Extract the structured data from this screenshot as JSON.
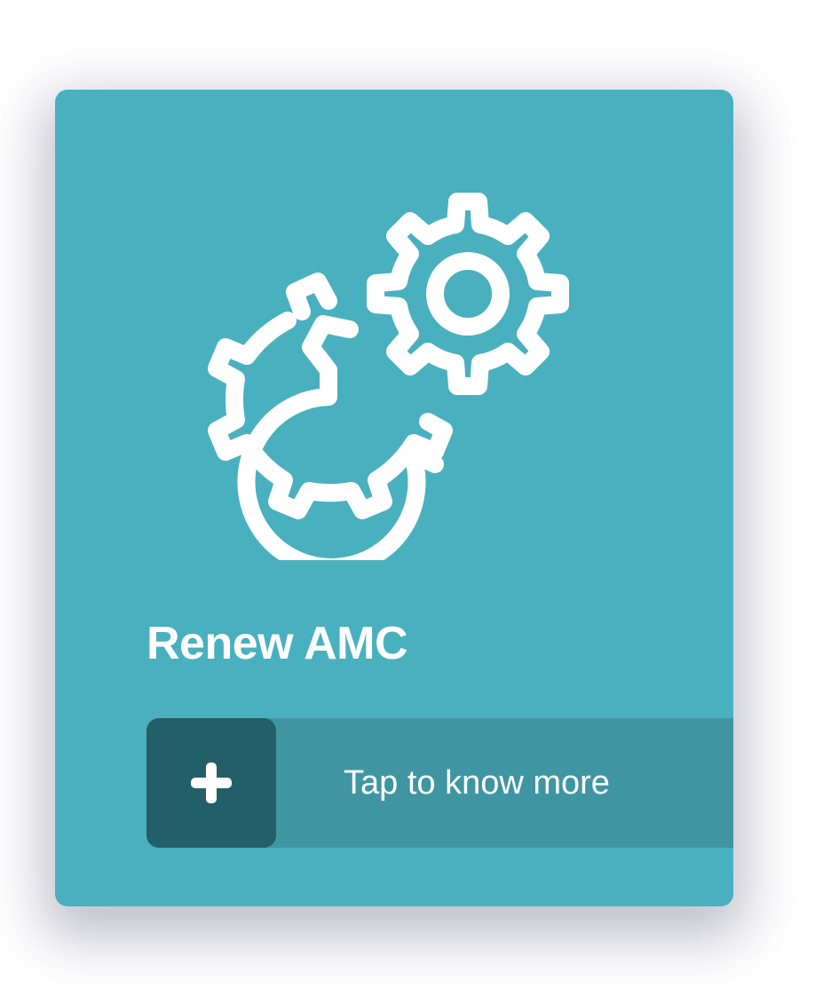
{
  "card": {
    "title": "Renew AMC",
    "icon": "gears-icon",
    "background_color": "#49b0bf",
    "cta": {
      "label": "Tap to know more",
      "icon": "plus-icon",
      "bar_color": "#3f96a2",
      "icon_box_color": "#235f68"
    }
  }
}
